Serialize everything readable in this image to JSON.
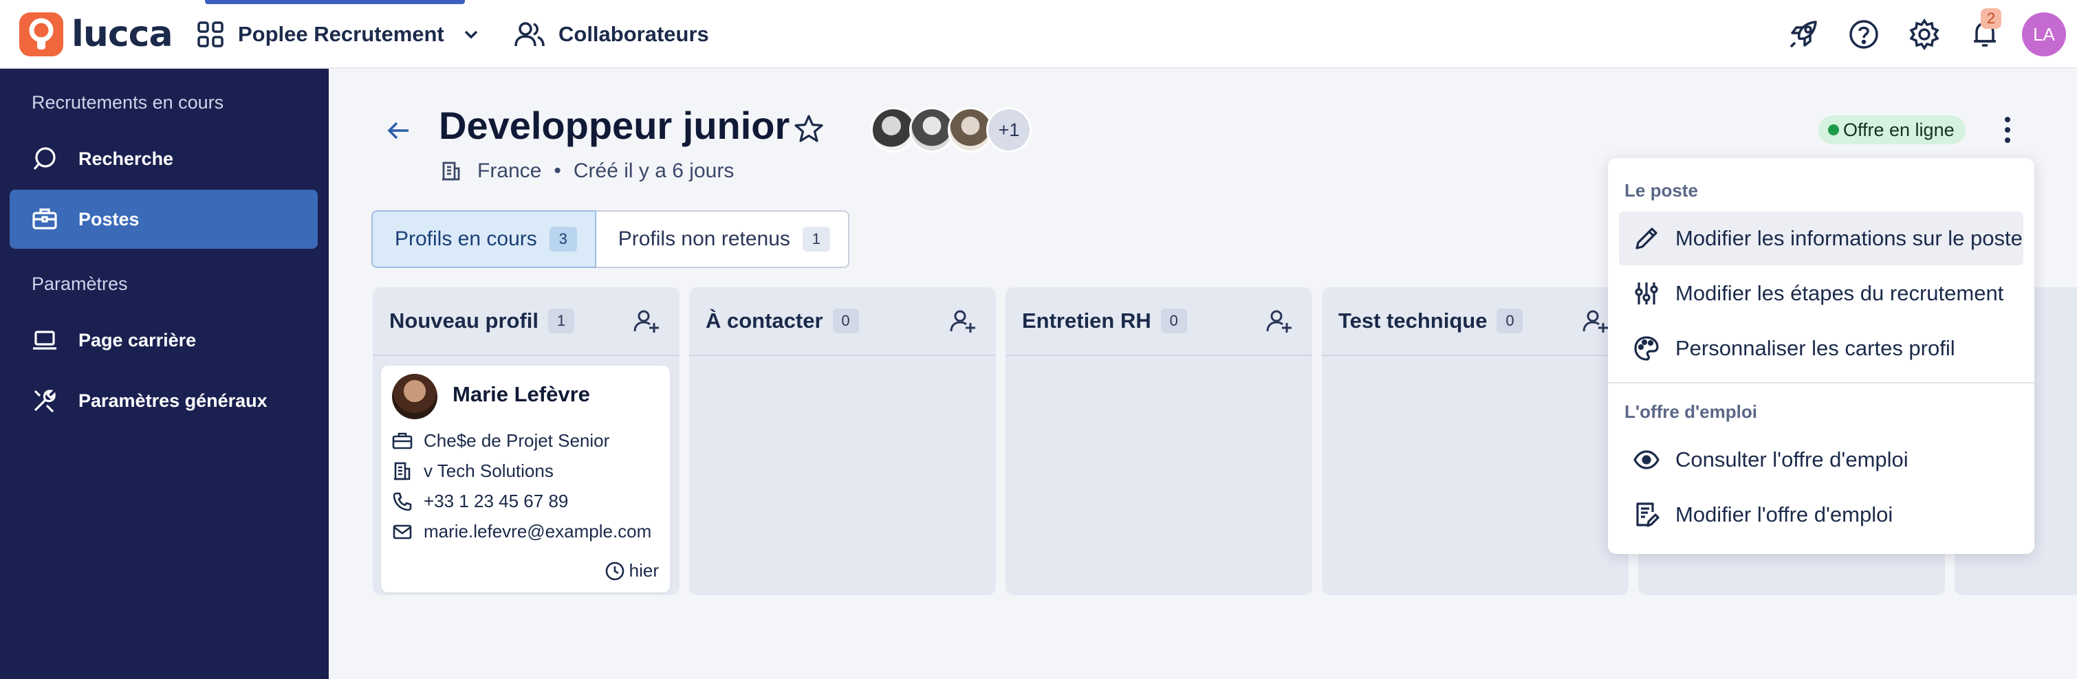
{
  "topbar": {
    "logo_text": "lucca",
    "app_name": "Poplee Recrutement",
    "collab_label": "Collaborateurs",
    "notif_count": "2",
    "user_initials": "LA",
    "accent": "#3c5fc1"
  },
  "sidebar": {
    "section1": "Recrutements en cours",
    "item_recherche": "Recherche",
    "item_postes": "Postes",
    "section2": "Paramètres",
    "item_page_carriere": "Page carrière",
    "item_parametres_generaux": "Paramètres généraux",
    "bg_color": "#1a2050",
    "active_color": "#3a6ab8"
  },
  "header": {
    "title": "Developpeur junior",
    "location": "France",
    "separator": "•",
    "created": "Créé il y a 6 jours",
    "team_more": "+1",
    "status": "Offre en ligne",
    "status_color": "#1f9a48"
  },
  "tabs": [
    {
      "label": "Profils en cours",
      "count": "3",
      "active": true
    },
    {
      "label": "Profils non retenus",
      "count": "1",
      "active": false
    }
  ],
  "columns": [
    {
      "title": "Nouveau profil",
      "count": "1"
    },
    {
      "title": "À contacter",
      "count": "0"
    },
    {
      "title": "Entretien RH",
      "count": "0"
    },
    {
      "title": "Test technique",
      "count": "0"
    }
  ],
  "card": {
    "name": "Marie Lefèvre",
    "job": "Che$e de Projet Senior",
    "company": "v Tech Solutions",
    "phone": "+33 1 23 45 67 89",
    "email": "marie.lefevre@example.com",
    "date": "hier"
  },
  "menu": {
    "group1": "Le poste",
    "item1": "Modifier les informations sur le poste",
    "item2": "Modifier les étapes du recrutement",
    "item3": "Personnaliser les cartes profil",
    "group2": "L'offre d'emploi",
    "item4": "Consulter l'offre d'emploi",
    "item5": "Modifier l'offre d'emploi"
  }
}
